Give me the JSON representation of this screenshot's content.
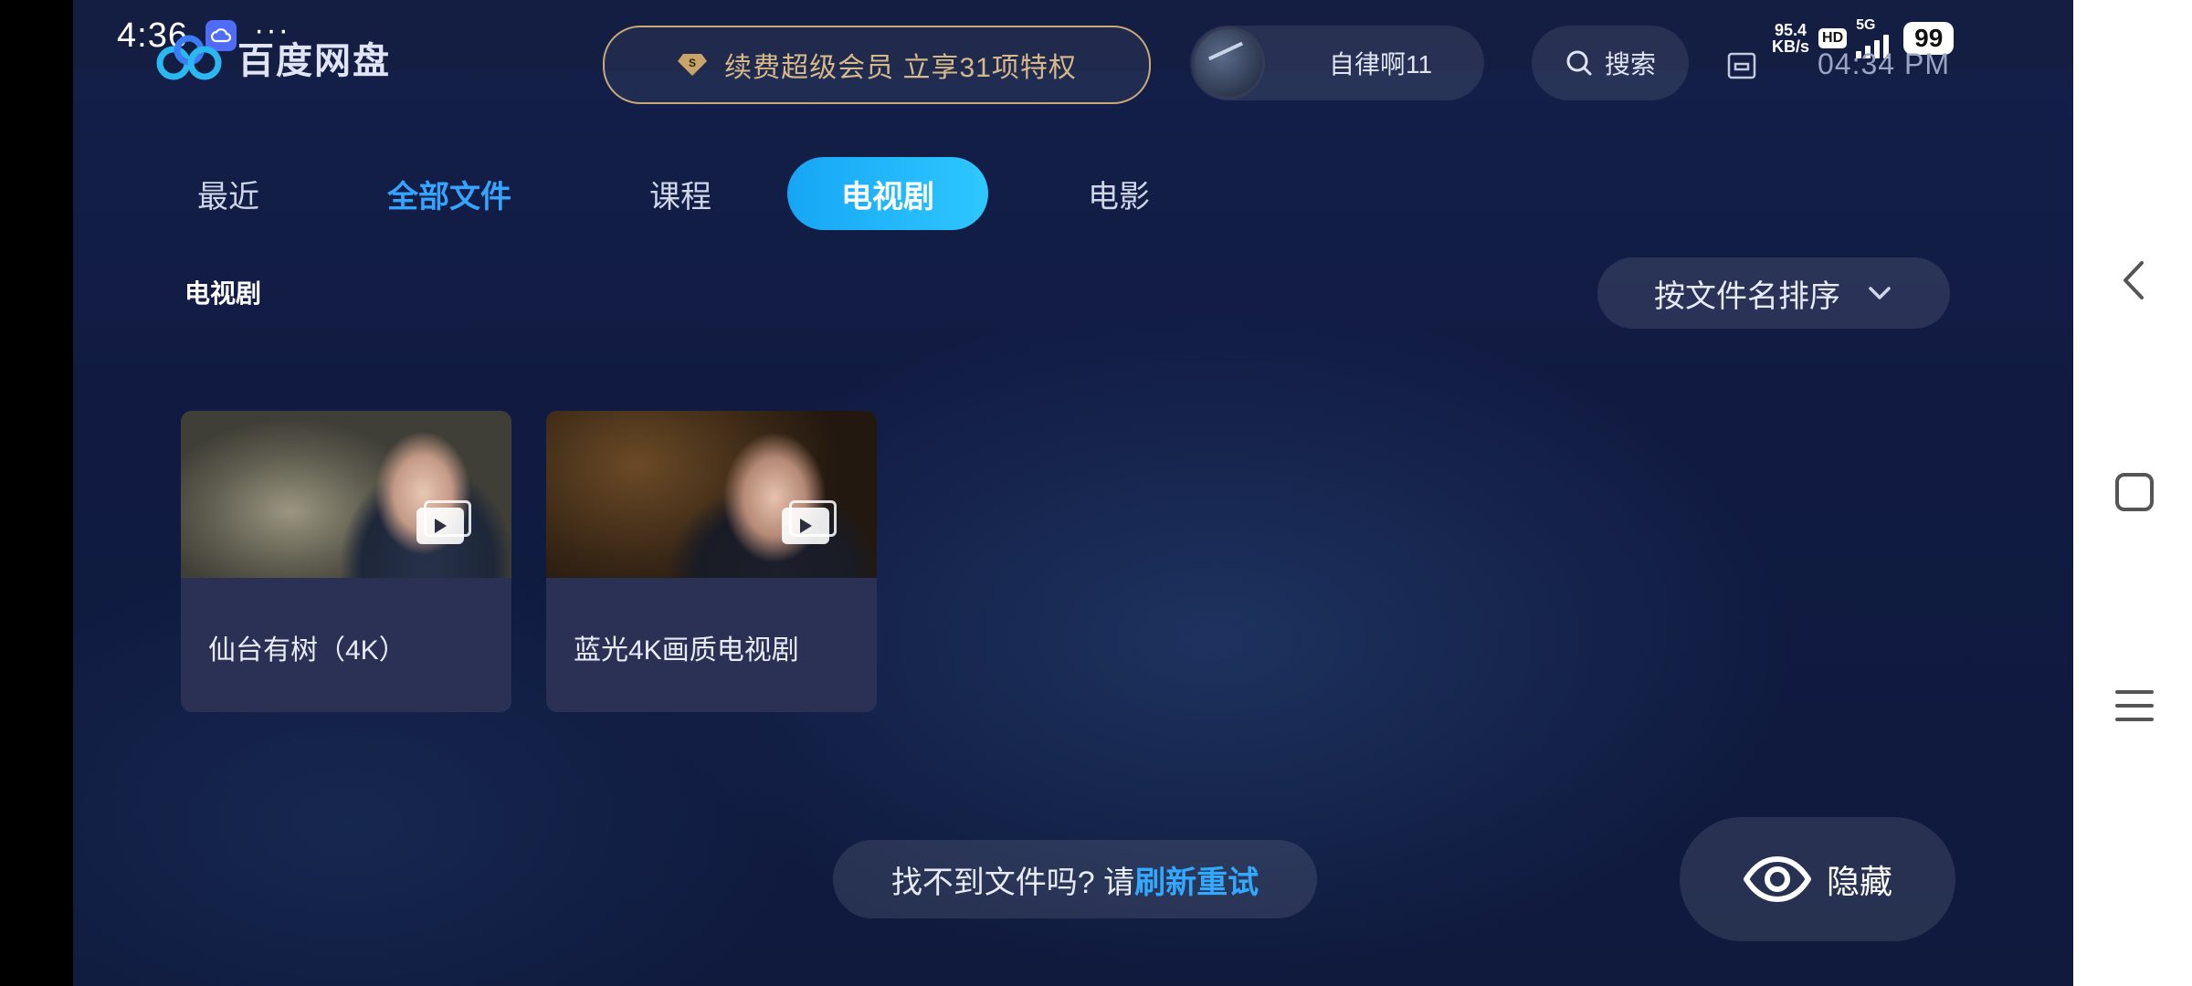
{
  "status_bar": {
    "time": "4:36",
    "more": "···",
    "net_speed_value": "95.4",
    "net_speed_unit": "KB/s",
    "hd": "HD",
    "network": "5G",
    "battery": "99"
  },
  "header": {
    "app_name": "百度网盘",
    "vip_banner": "续费超级会员 立享31项特权",
    "username": "自律啊11",
    "search_label": "搜索",
    "clock": "04:34 PM"
  },
  "tabs": [
    {
      "label": "最近"
    },
    {
      "label": "全部文件"
    },
    {
      "label": "课程"
    },
    {
      "label": "电视剧"
    },
    {
      "label": "电影"
    }
  ],
  "section": {
    "title": "电视剧",
    "sort_label": "按文件名排序"
  },
  "cards": [
    {
      "title": "仙台有树（4K）",
      "icon": "video-icon"
    },
    {
      "title": "蓝光4K画质电视剧",
      "icon": "video-icon"
    }
  ],
  "footer": {
    "refresh_prefix": "找不到文件吗? 请",
    "refresh_link": "刷新重试",
    "hide_label": "隐藏"
  },
  "colors": {
    "accent": "#35a4ff",
    "tab_selected_start": "#16a6f5",
    "tab_selected_end": "#2ec7ff",
    "vip_gold": "#d6b98a",
    "background": "#111b42"
  }
}
